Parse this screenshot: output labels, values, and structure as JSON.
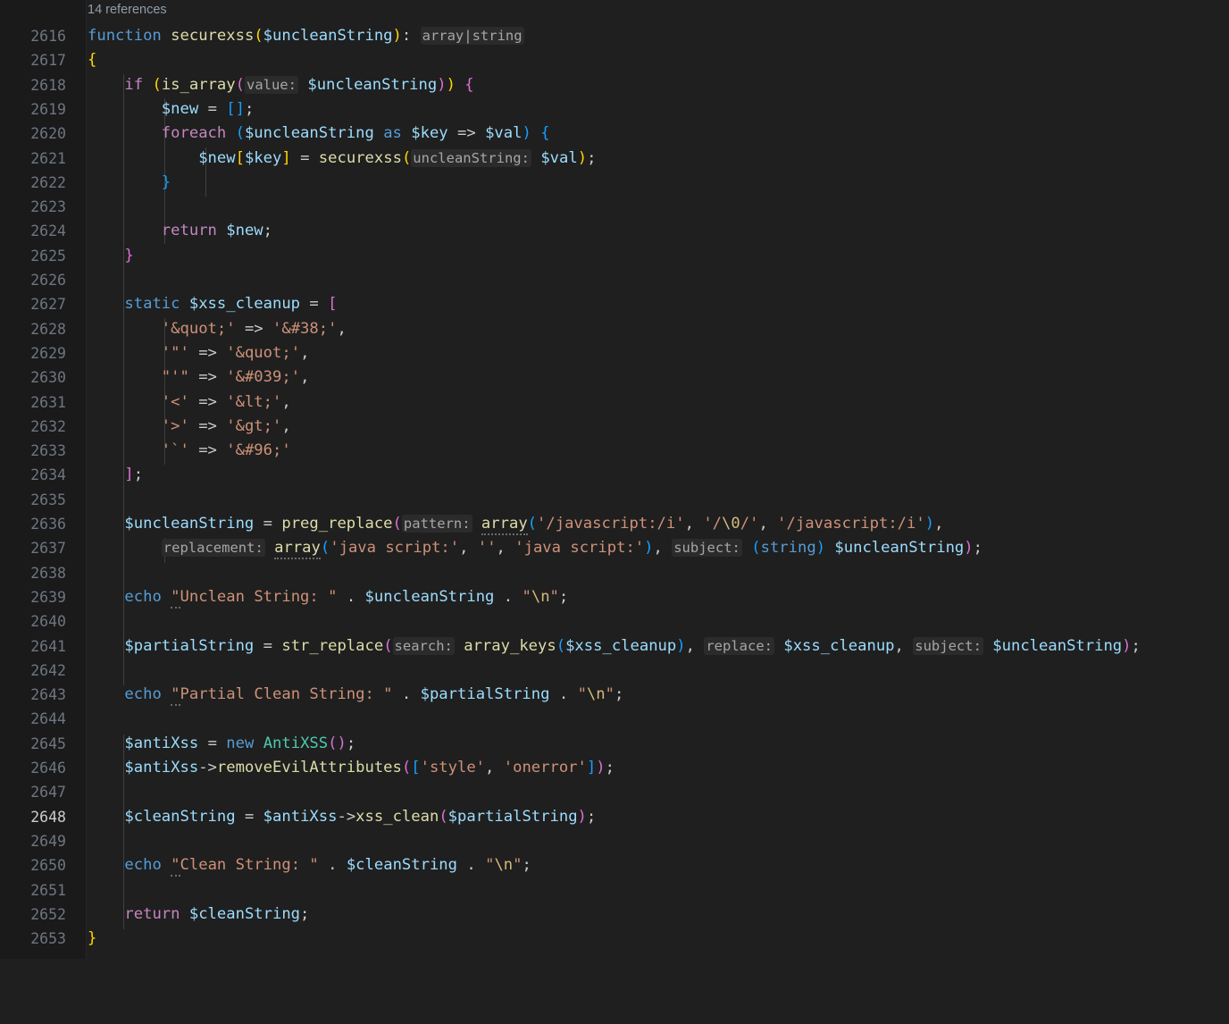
{
  "editor": {
    "language": "php",
    "background": "#1f1f1f",
    "gutter_background": "#1a1a1a",
    "current_line": 2648,
    "first_line": 2616,
    "last_line": 2653,
    "codelens": "14 references"
  },
  "colors": {
    "keyword": "#569cd6",
    "control": "#c586c0",
    "function": "#dcdcaa",
    "variable": "#9cdcfe",
    "class": "#4ec9b0",
    "string": "#ce9178",
    "escape": "#d7ba7d",
    "bracket1": "#ffd700",
    "bracket2": "#da70d6",
    "bracket3": "#179fff",
    "inlay_hint": "#a6a6a6",
    "codelens": "#919da9",
    "line_number": "#6e7681",
    "line_number_active": "#cccccc"
  },
  "lines": [
    {
      "n": "2616",
      "text": "function securexss($uncleanString): array|string"
    },
    {
      "n": "2617",
      "text": "{"
    },
    {
      "n": "2618",
      "text": "    if (is_array(value: $uncleanString)) {"
    },
    {
      "n": "2619",
      "text": "        $new = [];"
    },
    {
      "n": "2620",
      "text": "        foreach ($uncleanString as $key => $val) {"
    },
    {
      "n": "2621",
      "text": "            $new[$key] = securexss(uncleanString: $val);"
    },
    {
      "n": "2622",
      "text": "        }"
    },
    {
      "n": "2623",
      "text": ""
    },
    {
      "n": "2624",
      "text": "        return $new;"
    },
    {
      "n": "2625",
      "text": "    }"
    },
    {
      "n": "2626",
      "text": ""
    },
    {
      "n": "2627",
      "text": "    static $xss_cleanup = ["
    },
    {
      "n": "2628",
      "text": "        '&quot;' => '&#38;',"
    },
    {
      "n": "2629",
      "text": "        '\"' => '&quot;',"
    },
    {
      "n": "2630",
      "text": "        \"'\" => '&#039;',"
    },
    {
      "n": "2631",
      "text": "        '<' => '&lt;',"
    },
    {
      "n": "2632",
      "text": "        '>' => '&gt;',"
    },
    {
      "n": "2633",
      "text": "        '`' => '&#96;'"
    },
    {
      "n": "2634",
      "text": "    ];"
    },
    {
      "n": "2635",
      "text": ""
    },
    {
      "n": "2636",
      "text": "    $uncleanString = preg_replace(pattern: array('/javascript:/i', '/\\0/', '/javascript:/i'),"
    },
    {
      "n": "2637",
      "text": "        replacement: array('java script:', '', 'java script:'), subject: (string) $uncleanString);"
    },
    {
      "n": "2638",
      "text": ""
    },
    {
      "n": "2639",
      "text": "    echo \"Unclean String: \" . $uncleanString . \"\\n\";"
    },
    {
      "n": "2640",
      "text": ""
    },
    {
      "n": "2641",
      "text": "    $partialString = str_replace(search: array_keys($xss_cleanup), replace: $xss_cleanup, subject: $uncleanString);"
    },
    {
      "n": "2642",
      "text": ""
    },
    {
      "n": "2643",
      "text": "    echo \"Partial Clean String: \" . $partialString . \"\\n\";"
    },
    {
      "n": "2644",
      "text": ""
    },
    {
      "n": "2645",
      "text": "    $antiXss = new AntiXSS();"
    },
    {
      "n": "2646",
      "text": "    $antiXss->removeEvilAttributes(['style', 'onerror']);"
    },
    {
      "n": "2647",
      "text": ""
    },
    {
      "n": "2648",
      "text": "    $cleanString = $antiXss->xss_clean($partialString);"
    },
    {
      "n": "2649",
      "text": ""
    },
    {
      "n": "2650",
      "text": "    echo \"Clean String: \" . $cleanString . \"\\n\";"
    },
    {
      "n": "2651",
      "text": ""
    },
    {
      "n": "2652",
      "text": "    return $cleanString;"
    },
    {
      "n": "2653",
      "text": "}"
    }
  ]
}
